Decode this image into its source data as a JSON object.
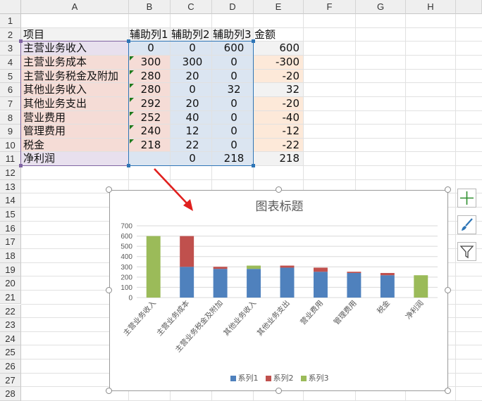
{
  "columns": [
    "A",
    "B",
    "C",
    "D",
    "E",
    "F",
    "G",
    "H"
  ],
  "rows": [
    "1",
    "2",
    "3",
    "4",
    "5",
    "6",
    "7",
    "8",
    "9",
    "10",
    "11",
    "12",
    "13",
    "14",
    "15",
    "16",
    "17",
    "18",
    "19",
    "20",
    "21",
    "22",
    "23",
    "24",
    "25",
    "26",
    "27",
    "28"
  ],
  "table": {
    "headers": [
      "项目",
      "辅助列1",
      "辅助列2",
      "辅助列3",
      "金额"
    ],
    "rows": [
      {
        "item": "主营业务收入",
        "c1": "0",
        "c2": "0",
        "c3": "600",
        "amt": "600"
      },
      {
        "item": "主营业务成本",
        "c1": "300",
        "c2": "300",
        "c3": "0",
        "amt": "-300"
      },
      {
        "item": "主营业务税金及附加",
        "c1": "280",
        "c2": "20",
        "c3": "0",
        "amt": "-20"
      },
      {
        "item": "其他业务收入",
        "c1": "280",
        "c2": "0",
        "c3": "32",
        "amt": "32"
      },
      {
        "item": "其他业务支出",
        "c1": "292",
        "c2": "20",
        "c3": "0",
        "amt": "-20"
      },
      {
        "item": "营业费用",
        "c1": "252",
        "c2": "40",
        "c3": "0",
        "amt": "-40"
      },
      {
        "item": "管理费用",
        "c1": "240",
        "c2": "12",
        "c3": "0",
        "amt": "-12"
      },
      {
        "item": "税金",
        "c1": "218",
        "c2": "22",
        "c3": "0",
        "amt": "-22"
      },
      {
        "item": "净利润",
        "c1": "",
        "c2": "0",
        "c3": "218",
        "amt": "218"
      }
    ]
  },
  "colors": {
    "series1": "#4f81bd",
    "series2": "#c0504d",
    "series3": "#9bbb59",
    "arrow": "#e0201e"
  },
  "side_buttons": [
    "plus-icon",
    "brush-icon",
    "filter-icon"
  ],
  "chart_data": {
    "type": "bar",
    "stacked": true,
    "title": "图表标题",
    "categories": [
      "主营业务收入",
      "主营业务成本",
      "主营业务税金及附加",
      "其他业务收入",
      "其他业务支出",
      "营业费用",
      "管理费用",
      "税金",
      "净利润"
    ],
    "series": [
      {
        "name": "系列1",
        "values": [
          0,
          300,
          280,
          280,
          292,
          252,
          240,
          218,
          0
        ]
      },
      {
        "name": "系列2",
        "values": [
          0,
          300,
          20,
          0,
          20,
          40,
          12,
          22,
          0
        ]
      },
      {
        "name": "系列3",
        "values": [
          600,
          0,
          0,
          32,
          0,
          0,
          0,
          0,
          218
        ]
      }
    ],
    "ylim": [
      0,
      700
    ],
    "yticks": [
      0,
      100,
      200,
      300,
      400,
      500,
      600,
      700
    ],
    "legend": "bottom",
    "grid": true
  }
}
